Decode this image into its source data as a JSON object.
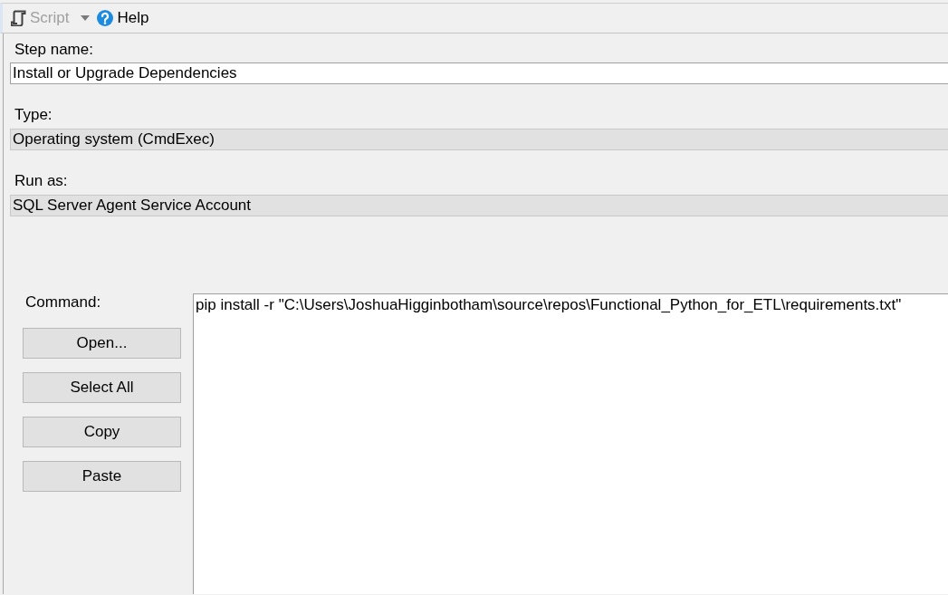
{
  "toolbar": {
    "items": [
      {
        "kind": "split",
        "label": "Script",
        "disabled": true
      },
      {
        "kind": "help",
        "label": "Help",
        "disabled": false
      }
    ]
  },
  "fields": [
    {
      "label": "Step name:",
      "value": "Install or Upgrade Dependencies",
      "disabled": false
    },
    {
      "label": "Type:",
      "value": "Operating system (CmdExec)",
      "disabled": true
    },
    {
      "label": "Run as:",
      "value": "SQL Server Agent Service Account",
      "disabled": true
    }
  ],
  "command": {
    "label": "Command:",
    "value": "pip install -r \"C:\\Users\\JoshuaHigginbotham\\source\\repos\\Functional_Python_for_ETL\\requirements.txt\"",
    "buttons": [
      "Open...",
      "Select All",
      "Copy",
      "Paste"
    ]
  }
}
